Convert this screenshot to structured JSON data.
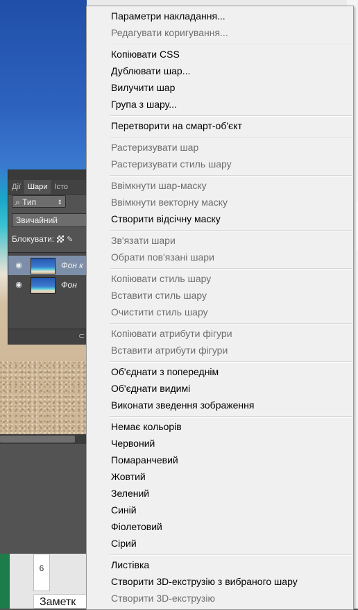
{
  "background": {
    "ruler_label": "6",
    "note_label": "Заметк"
  },
  "layers_panel": {
    "tabs": [
      "Дії",
      "Шари",
      "Істо"
    ],
    "filter_label": "Тип",
    "blend_mode": "Звичайний",
    "lock_label": "Блокувати:",
    "layers": [
      {
        "name": "Фон к",
        "selected": true
      },
      {
        "name": "Фон",
        "selected": false
      }
    ]
  },
  "menu": {
    "items": [
      {
        "label": "Параметри накладання...",
        "enabled": true
      },
      {
        "label": "Редагувати коригування...",
        "enabled": false
      },
      {
        "label": "Копіювати CSS",
        "enabled": true
      },
      {
        "label": "Дублювати шар...",
        "enabled": true
      },
      {
        "label": "Вилучити шар",
        "enabled": true
      },
      {
        "label": "Група з шару...",
        "enabled": true
      },
      {
        "label": "Перетворити на смарт-об'єкт",
        "enabled": true
      },
      {
        "label": "Растеризувати шар",
        "enabled": false
      },
      {
        "label": "Растеризувати стиль шару",
        "enabled": false
      },
      {
        "label": "Ввімкнути шар-маску",
        "enabled": false
      },
      {
        "label": "Ввімкнути векторну маску",
        "enabled": false
      },
      {
        "label": "Створити відсічну маску",
        "enabled": true
      },
      {
        "label": "Зв'язати шари",
        "enabled": false
      },
      {
        "label": "Обрати пов'язані шари",
        "enabled": false
      },
      {
        "label": "Копіювати стиль шару",
        "enabled": false
      },
      {
        "label": "Вставити стиль шару",
        "enabled": false
      },
      {
        "label": "Очистити стиль шару",
        "enabled": false
      },
      {
        "label": "Копіювати атрибути фігури",
        "enabled": false
      },
      {
        "label": "Вставити атрибути фігури",
        "enabled": false
      },
      {
        "label": "Об'єднати з попереднім",
        "enabled": true
      },
      {
        "label": "Об'єднати видимі",
        "enabled": true
      },
      {
        "label": "Виконати зведення зображення",
        "enabled": true
      },
      {
        "label": "Немає кольорів",
        "enabled": true
      },
      {
        "label": "Червоний",
        "enabled": true
      },
      {
        "label": "Помаранчевий",
        "enabled": true
      },
      {
        "label": "Жовтий",
        "enabled": true
      },
      {
        "label": "Зелений",
        "enabled": true
      },
      {
        "label": "Синій",
        "enabled": true
      },
      {
        "label": "Фіолетовий",
        "enabled": true
      },
      {
        "label": "Сірий",
        "enabled": true
      },
      {
        "label": "Листівка",
        "enabled": true
      },
      {
        "label": "Створити 3D-екструзію з вибраного шару",
        "enabled": true
      },
      {
        "label": "Створити 3D-екструзію",
        "enabled": false
      }
    ]
  }
}
